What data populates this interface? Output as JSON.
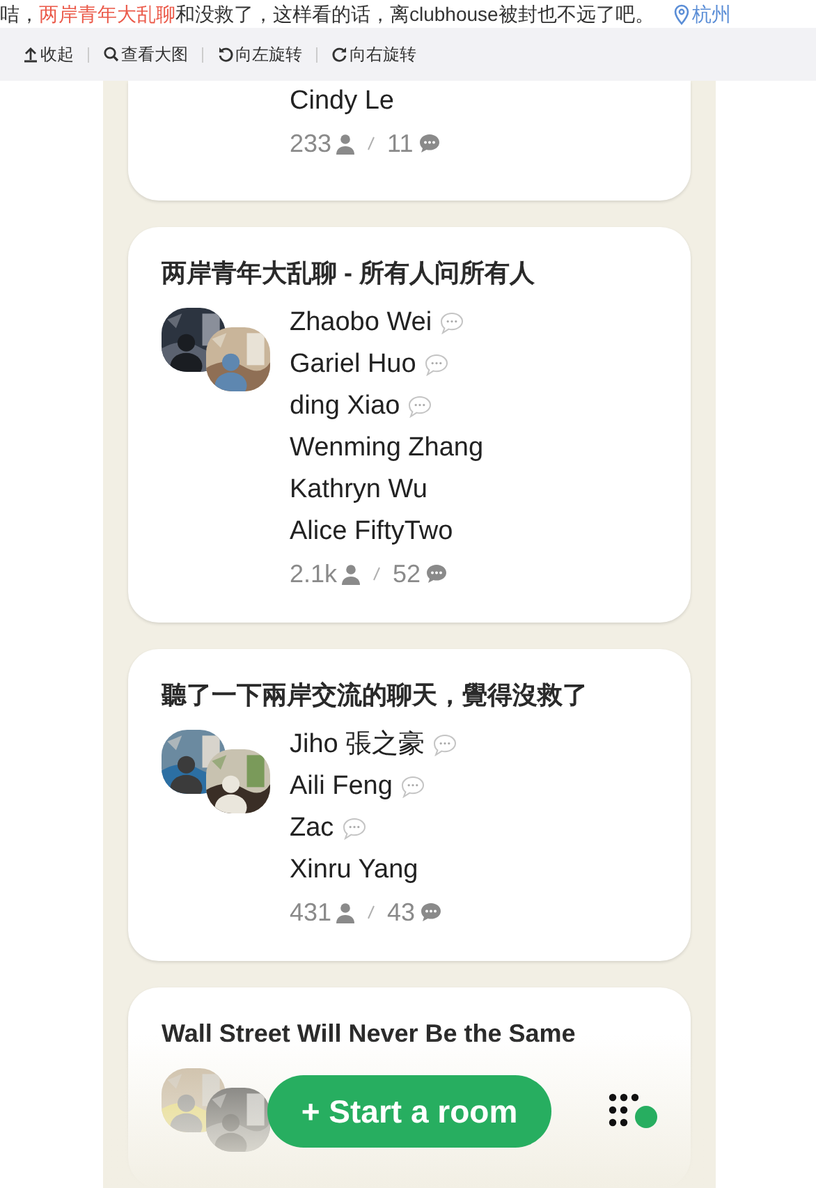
{
  "post_text": {
    "before": "咭，",
    "link": "两岸青年大乱聊",
    "after": "和没救了，这样看的话，离clubhouse被封也不远了吧。",
    "location": "杭州"
  },
  "toolbar": [
    {
      "label": "收起",
      "kind": "collapse"
    },
    {
      "label": "查看大图",
      "kind": "zoom"
    },
    {
      "label": "向左旋转",
      "kind": "rotate-left"
    },
    {
      "label": "向右旋转",
      "kind": "rotate-right"
    }
  ],
  "rooms": [
    {
      "speakers": [
        {
          "name": "Cindy Le",
          "speaker": false
        }
      ],
      "listeners": "233",
      "chats": "11"
    },
    {
      "title": "两岸青年大乱聊 - 所有人问所有人",
      "speakers": [
        {
          "name": "Zhaobo Wei",
          "speaker": true
        },
        {
          "name": "Gariel Huo",
          "speaker": true
        },
        {
          "name": "ding Xiao",
          "speaker": true
        },
        {
          "name": "Wenming Zhang",
          "speaker": false
        },
        {
          "name": "Kathryn Wu",
          "speaker": false
        },
        {
          "name": "Alice FiftyTwo",
          "speaker": false
        }
      ],
      "listeners": "2.1k",
      "chats": "52"
    },
    {
      "title": "聽了一下兩岸交流的聊天，覺得沒救了",
      "speakers": [
        {
          "name": "Jiho 張之豪",
          "speaker": true
        },
        {
          "name": "Aili Feng",
          "speaker": true
        },
        {
          "name": "Zac",
          "speaker": true
        },
        {
          "name": "Xinru Yang",
          "speaker": false
        }
      ],
      "listeners": "431",
      "chats": "43"
    },
    {
      "title": "Wall Street Will Never Be the Same"
    }
  ],
  "start_button": {
    "label": "+ Start a room"
  }
}
